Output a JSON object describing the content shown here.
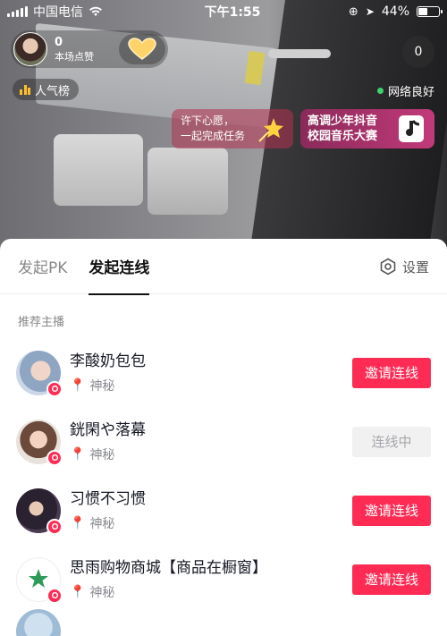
{
  "status_bar": {
    "carrier": "中国电信",
    "time": "下午1:55",
    "battery": "44%",
    "battery_level": 0.44
  },
  "host": {
    "likes": "0",
    "likes_label": "本场点赞"
  },
  "viewer_count": "0",
  "popularity_label": "人气榜",
  "network_status": "网络良好",
  "banners": {
    "task_line1": "许下心愿，",
    "task_line2": "一起完成任务",
    "music_line1": "高调少年抖音",
    "music_line2": "校园音乐大赛"
  },
  "sheet": {
    "tabs": [
      {
        "label": "发起PK",
        "active": false
      },
      {
        "label": "发起连线",
        "active": true
      }
    ],
    "settings_label": "设置",
    "section_title": "推荐主播",
    "streamers": [
      {
        "name": "李酸奶包包",
        "location": "神秘",
        "action": "邀请连线",
        "state": "invite"
      },
      {
        "name": "銧閑や落幕",
        "location": "神秘",
        "action": "连线中",
        "state": "pending"
      },
      {
        "name": "习惯不习惯",
        "location": "神秘",
        "action": "邀请连线",
        "state": "invite"
      },
      {
        "name": "思雨购物商城【商品在橱窗】",
        "location": "神秘",
        "action": "邀请连线",
        "state": "invite"
      }
    ]
  },
  "colors": {
    "accent": "#fe2c55",
    "pending_bg": "#f1f1f2",
    "network_dot": "#3ed36a"
  }
}
